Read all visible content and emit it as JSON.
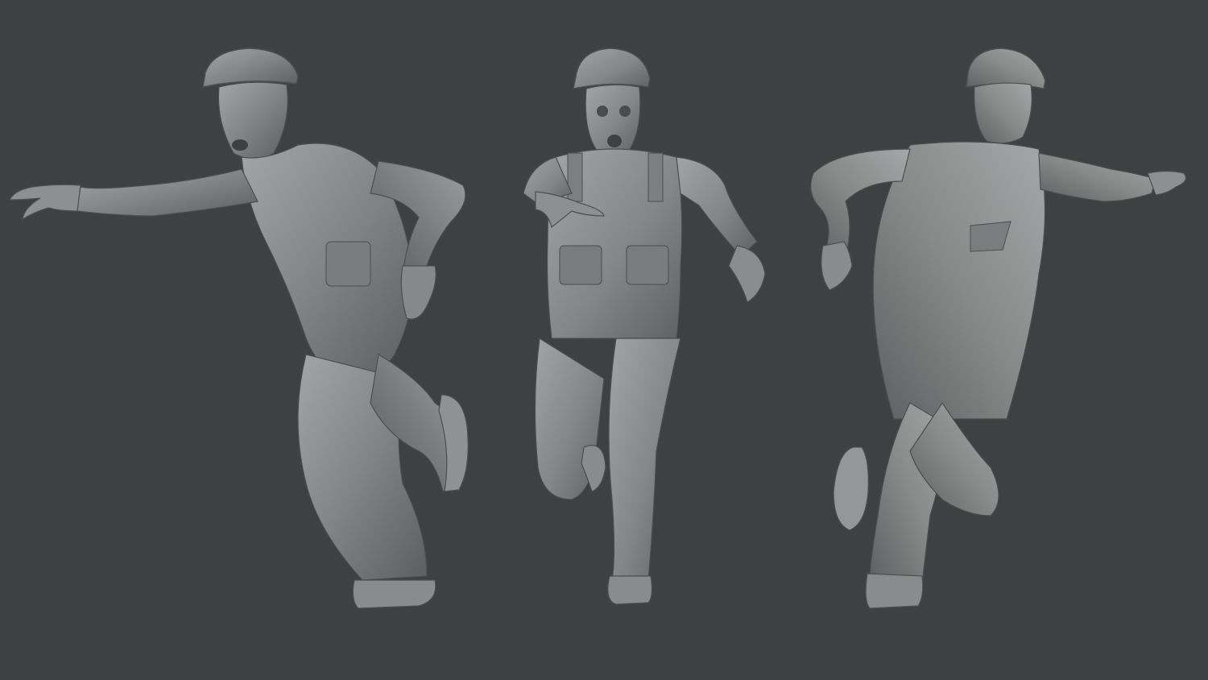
{
  "scene": {
    "background_color": "#3f4041",
    "material_color": "#8a8b8c",
    "views": [
      {
        "id": "side",
        "icon": "zombie-figure-side-view-icon"
      },
      {
        "id": "front",
        "icon": "zombie-figure-front-view-icon"
      },
      {
        "id": "back",
        "icon": "zombie-figure-back-view-icon"
      }
    ]
  }
}
